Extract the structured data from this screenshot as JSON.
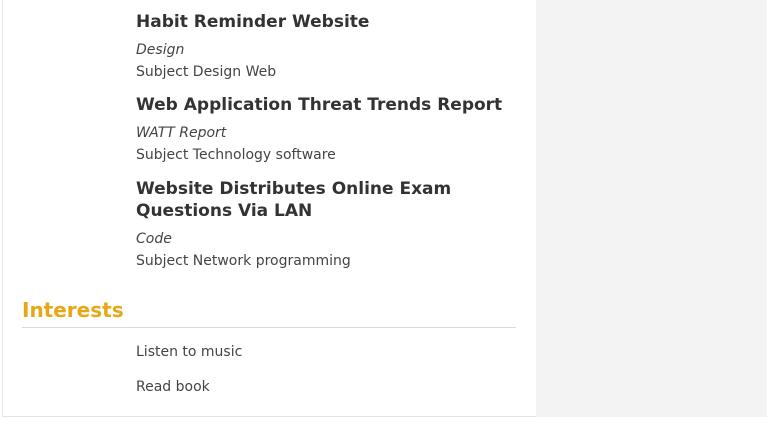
{
  "projects": [
    {
      "title": "Habit Reminder Website",
      "type": "Design",
      "subject": "Subject Design Web"
    },
    {
      "title": "Web Application Threat Trends Report",
      "type": "WATT Report",
      "subject": "Subject Technology software"
    },
    {
      "title": "Website Distributes Online Exam Questions Via LAN",
      "type": "Code",
      "subject": "Subject Network programming"
    }
  ],
  "interests": {
    "heading": "Interests",
    "items": [
      "Listen to music",
      "Read book"
    ]
  },
  "colors": {
    "accent": "#e6a817",
    "text": "#333333",
    "sidebar": "#f3f3f3"
  }
}
